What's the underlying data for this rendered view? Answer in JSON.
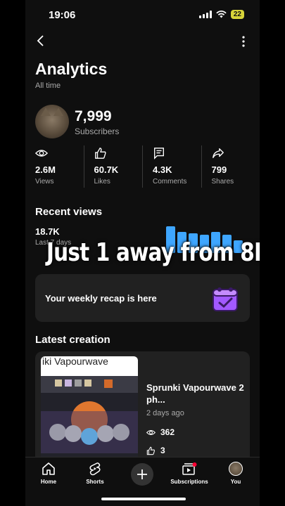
{
  "status_bar": {
    "time": "19:06",
    "battery": "22"
  },
  "header": {
    "title": "Analytics",
    "subtitle": "All time",
    "back_icon": "chevron-left-icon",
    "more_icon": "more-vertical-icon"
  },
  "channel": {
    "subscribers": "7,999",
    "subscribers_label": "Subscribers"
  },
  "stats": [
    {
      "value": "2.6M",
      "label": "Views",
      "icon": "eye-icon"
    },
    {
      "value": "60.7K",
      "label": "Likes",
      "icon": "thumbs-up-icon"
    },
    {
      "value": "4.3K",
      "label": "Comments",
      "icon": "comment-icon"
    },
    {
      "value": "799",
      "label": "Shares",
      "icon": "share-icon"
    }
  ],
  "recent_views": {
    "heading": "Recent views",
    "value": "18.7K",
    "period": "Last 7 days",
    "bar_color": "#3ea6ff"
  },
  "overlay_caption": "Just 1 away from 8K",
  "recap": {
    "text": "Your weekly recap is here",
    "icon": "calendar-check-icon",
    "icon_color": "#a259ff"
  },
  "latest": {
    "heading": "Latest creation",
    "thumbnail_text": "iki Vapourwave",
    "video_title": "Sprunki Vapourwave 2 ph...",
    "age": "2 days ago",
    "views": "362",
    "likes": "3"
  },
  "nav": {
    "items": [
      {
        "label": "Home",
        "icon": "home-icon"
      },
      {
        "label": "Shorts",
        "icon": "shorts-icon"
      },
      {
        "label": "",
        "icon": "create-plus-icon"
      },
      {
        "label": "Subscriptions",
        "icon": "subscriptions-icon"
      },
      {
        "label": "You",
        "icon": "avatar"
      }
    ]
  }
}
